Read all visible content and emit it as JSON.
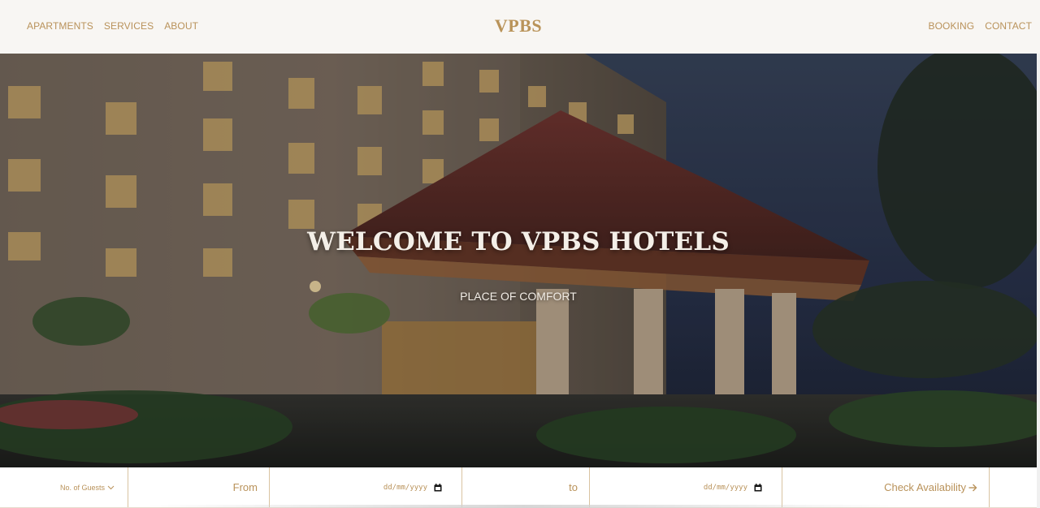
{
  "header": {
    "brand": "VPBS",
    "nav_left": [
      "APARTMENTS",
      "SERVICES",
      "ABOUT"
    ],
    "nav_right": [
      "BOOKING",
      "CONTACT"
    ]
  },
  "hero": {
    "title": "WELCOME TO VPBS HOTELS",
    "subtitle": "PLACE OF COMFORT"
  },
  "booking": {
    "guests_placeholder": "No. of Guests",
    "from_label": "From",
    "from_date_placeholder": "dd/mm/yyyy",
    "to_label": "to",
    "to_date_placeholder": "dd/mm/yyyy",
    "check_label": "Check Availability"
  },
  "colors": {
    "accent": "#b9925a",
    "header_bg": "#f8f6f3",
    "divider": "#d9c3a1"
  },
  "icons": {
    "guests_dropdown": "chevron-down-icon",
    "date_picker": "calendar-icon",
    "check_arrow": "arrow-right-icon"
  }
}
